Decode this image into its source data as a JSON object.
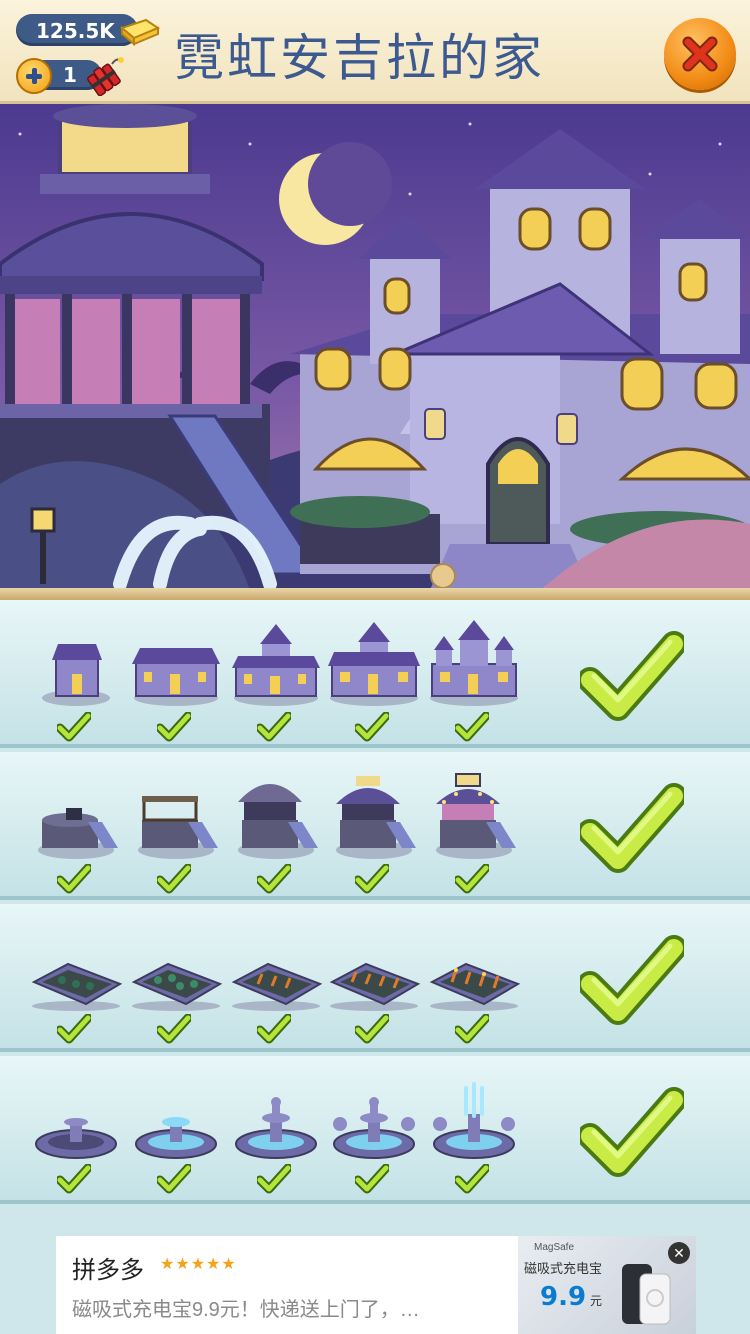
{
  "header": {
    "title": "霓虹安吉拉的家",
    "gold_value": "125.5K",
    "dynamite_count": "1"
  },
  "ad": {
    "brand": "拼多多",
    "stars": "★★★★★",
    "text": "磁吸式充电宝9.9元！快递送上门了，…",
    "image_tag": "MagSafe",
    "image_product": "磁吸式充电宝",
    "image_price": "9.9",
    "image_price_unit": "元"
  }
}
